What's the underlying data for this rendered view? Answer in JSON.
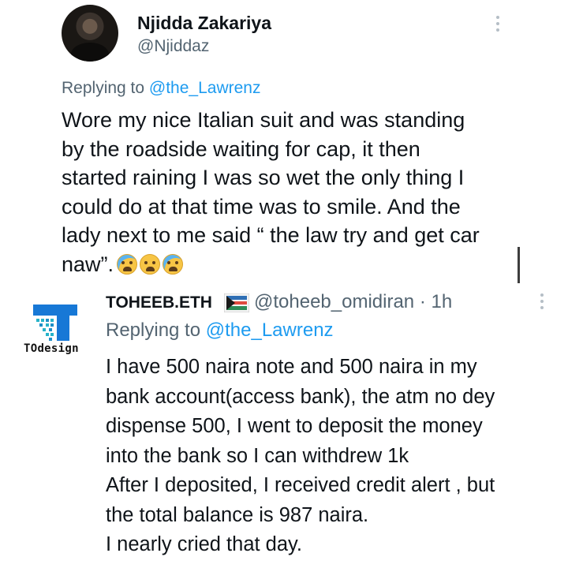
{
  "tweet1": {
    "display_name": "Njidda Zakariya",
    "handle": "@Njiddaz",
    "replying_prefix": "Replying to ",
    "replying_handle": "@the_Lawrenz",
    "body": "Wore my nice Italian suit and was standing\nby the roadside waiting for cap, it then\nstarted raining I was so wet the only thing I\ncould do at that time was to smile. And the\nlady next to me said “ the law try and get car\nnaw”.",
    "emojis": [
      "loudly-crying-face-emoji",
      "weary-face-emoji",
      "loudly-crying-face-emoji"
    ]
  },
  "tweet2": {
    "display_name": "TOHEEB.ETH",
    "handle_time": "@toheeb_omidiran · 1h",
    "avatar_logo_text": "TOdesign",
    "replying_prefix": "Replying to ",
    "replying_handle": "@the_Lawrenz",
    "body": "I have 500 naira note and 500 naira in my\nbank account(access bank), the atm no dey\ndispense 500, I went to deposit the money\ninto the bank so I can withdrew 1k\n After I deposited,  I received credit alert , but\nthe total balance is 987 naira.\nI nearly  cried that day."
  },
  "colors": {
    "text": "#0f1419",
    "secondary": "#536471",
    "link": "#1d9bf0"
  }
}
